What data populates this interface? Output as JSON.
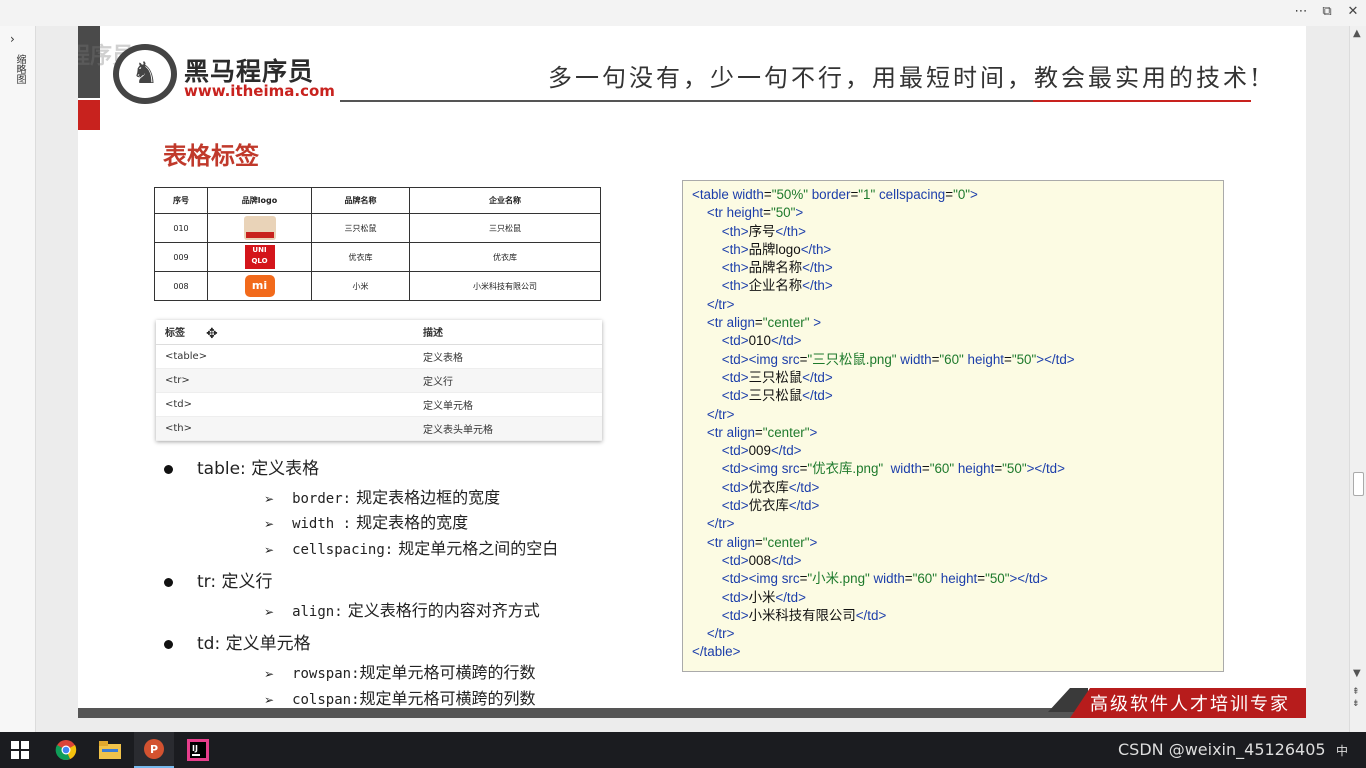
{
  "window": {
    "more_icon": "⋯",
    "restore_icon": "⧉",
    "close_icon": "✕",
    "side_arrow": "›",
    "side_label": "缩略图"
  },
  "slide": {
    "watermark": "黑马程序员",
    "logo_cn": "黑马程序员",
    "logo_url": "www.itheima.com",
    "slogan": "多一句没有，少一句不行，用最短时间，教会最实用的技术!",
    "title": "表格标签",
    "brand_table": {
      "headers": [
        "序号",
        "品牌logo",
        "品牌名称",
        "企业名称"
      ],
      "rows": [
        {
          "id": "010",
          "logo": "三只松鼠",
          "name": "三只松鼠",
          "company": "三只松鼠"
        },
        {
          "id": "009",
          "logo": "UNI QLO",
          "name": "优衣库",
          "company": "优衣库"
        },
        {
          "id": "008",
          "logo": "mi",
          "name": "小米",
          "company": "小米科技有限公司"
        }
      ]
    },
    "tag_table": {
      "headers": [
        "标签",
        "描述"
      ],
      "rows": [
        {
          "tag": "<table>",
          "desc": "定义表格"
        },
        {
          "tag": "<tr>",
          "desc": "定义行"
        },
        {
          "tag": "<td>",
          "desc": "定义单元格"
        },
        {
          "tag": "<th>",
          "desc": "定义表头单元格"
        }
      ]
    },
    "bullets": [
      {
        "label": "table: 定义表格",
        "subs": [
          {
            "code": "border:",
            "text": " 规定表格边框的宽度"
          },
          {
            "code": "width :",
            "text": " 规定表格的宽度"
          },
          {
            "code": "cellspacing:",
            "text": " 规定单元格之间的空白"
          }
        ]
      },
      {
        "label": "tr: 定义行",
        "subs": [
          {
            "code": "align:",
            "text": " 定义表格行的内容对齐方式"
          }
        ]
      },
      {
        "label": "td: 定义单元格",
        "subs": [
          {
            "code": "rowspan:",
            "text": "规定单元格可横跨的行数"
          },
          {
            "code": "colspan:",
            "text": "规定单元格可横跨的列数"
          }
        ]
      }
    ],
    "code_lines": [
      "<table width=\"50%\" border=\"1\" cellspacing=\"0\">",
      "    <tr height=\"50\">",
      "        <th>序号</th>",
      "        <th>品牌logo</th>",
      "        <th>品牌名称</th>",
      "        <th>企业名称</th>",
      "    </tr>",
      "    <tr align=\"center\" >",
      "        <td>010</td>",
      "        <td><img src=\"三只松鼠.png\" width=\"60\" height=\"50\"></td>",
      "        <td>三只松鼠</td>",
      "        <td>三只松鼠</td>",
      "    </tr>",
      "    <tr align=\"center\">",
      "        <td>009</td>",
      "        <td><img src=\"优衣库.png\"  width=\"60\" height=\"50\"></td>",
      "        <td>优衣库</td>",
      "        <td>优衣库</td>",
      "    </tr>",
      "    <tr align=\"center\">",
      "        <td>008</td>",
      "        <td><img src=\"小米.png\" width=\"60\" height=\"50\"></td>",
      "        <td>小米</td>",
      "        <td>小米科技有限公司</td>",
      "    </tr>",
      "</table>"
    ],
    "footer_slogan": "高级软件人才培训专家"
  },
  "taskbar": {
    "apps": [
      "windows-start",
      "chrome",
      "file-explorer",
      "powerpoint",
      "jetbrains-ide"
    ],
    "watermark": "CSDN @weixin_45126405",
    "ime": "中"
  },
  "colors": {
    "accent_red": "#c8221e",
    "title_red": "#c0392b",
    "code_bg": "#fcfbe3",
    "code_tag": "#1c3eaa",
    "code_value": "#1e7a2c"
  }
}
